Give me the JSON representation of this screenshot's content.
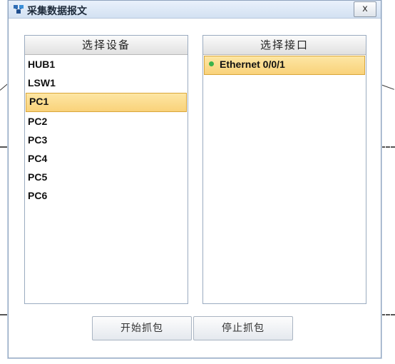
{
  "window": {
    "title": "采集数据报文",
    "close_label": "x"
  },
  "devices": {
    "header": "选择设备",
    "items": [
      "HUB1",
      "LSW1",
      "PC1",
      "PC2",
      "PC3",
      "PC4",
      "PC5",
      "PC6"
    ],
    "selected": "PC1"
  },
  "interfaces": {
    "header": "选择接口",
    "items": [
      {
        "label": "Ethernet 0/0/1",
        "status": "up",
        "status_color": "#3cb34a"
      }
    ]
  },
  "buttons": {
    "start": "开始抓包",
    "stop": "停止抓包"
  },
  "colors": {
    "selection": "#f9d27a",
    "title_bar": "#d3e1f2",
    "panel_border": "#9aabc0"
  }
}
